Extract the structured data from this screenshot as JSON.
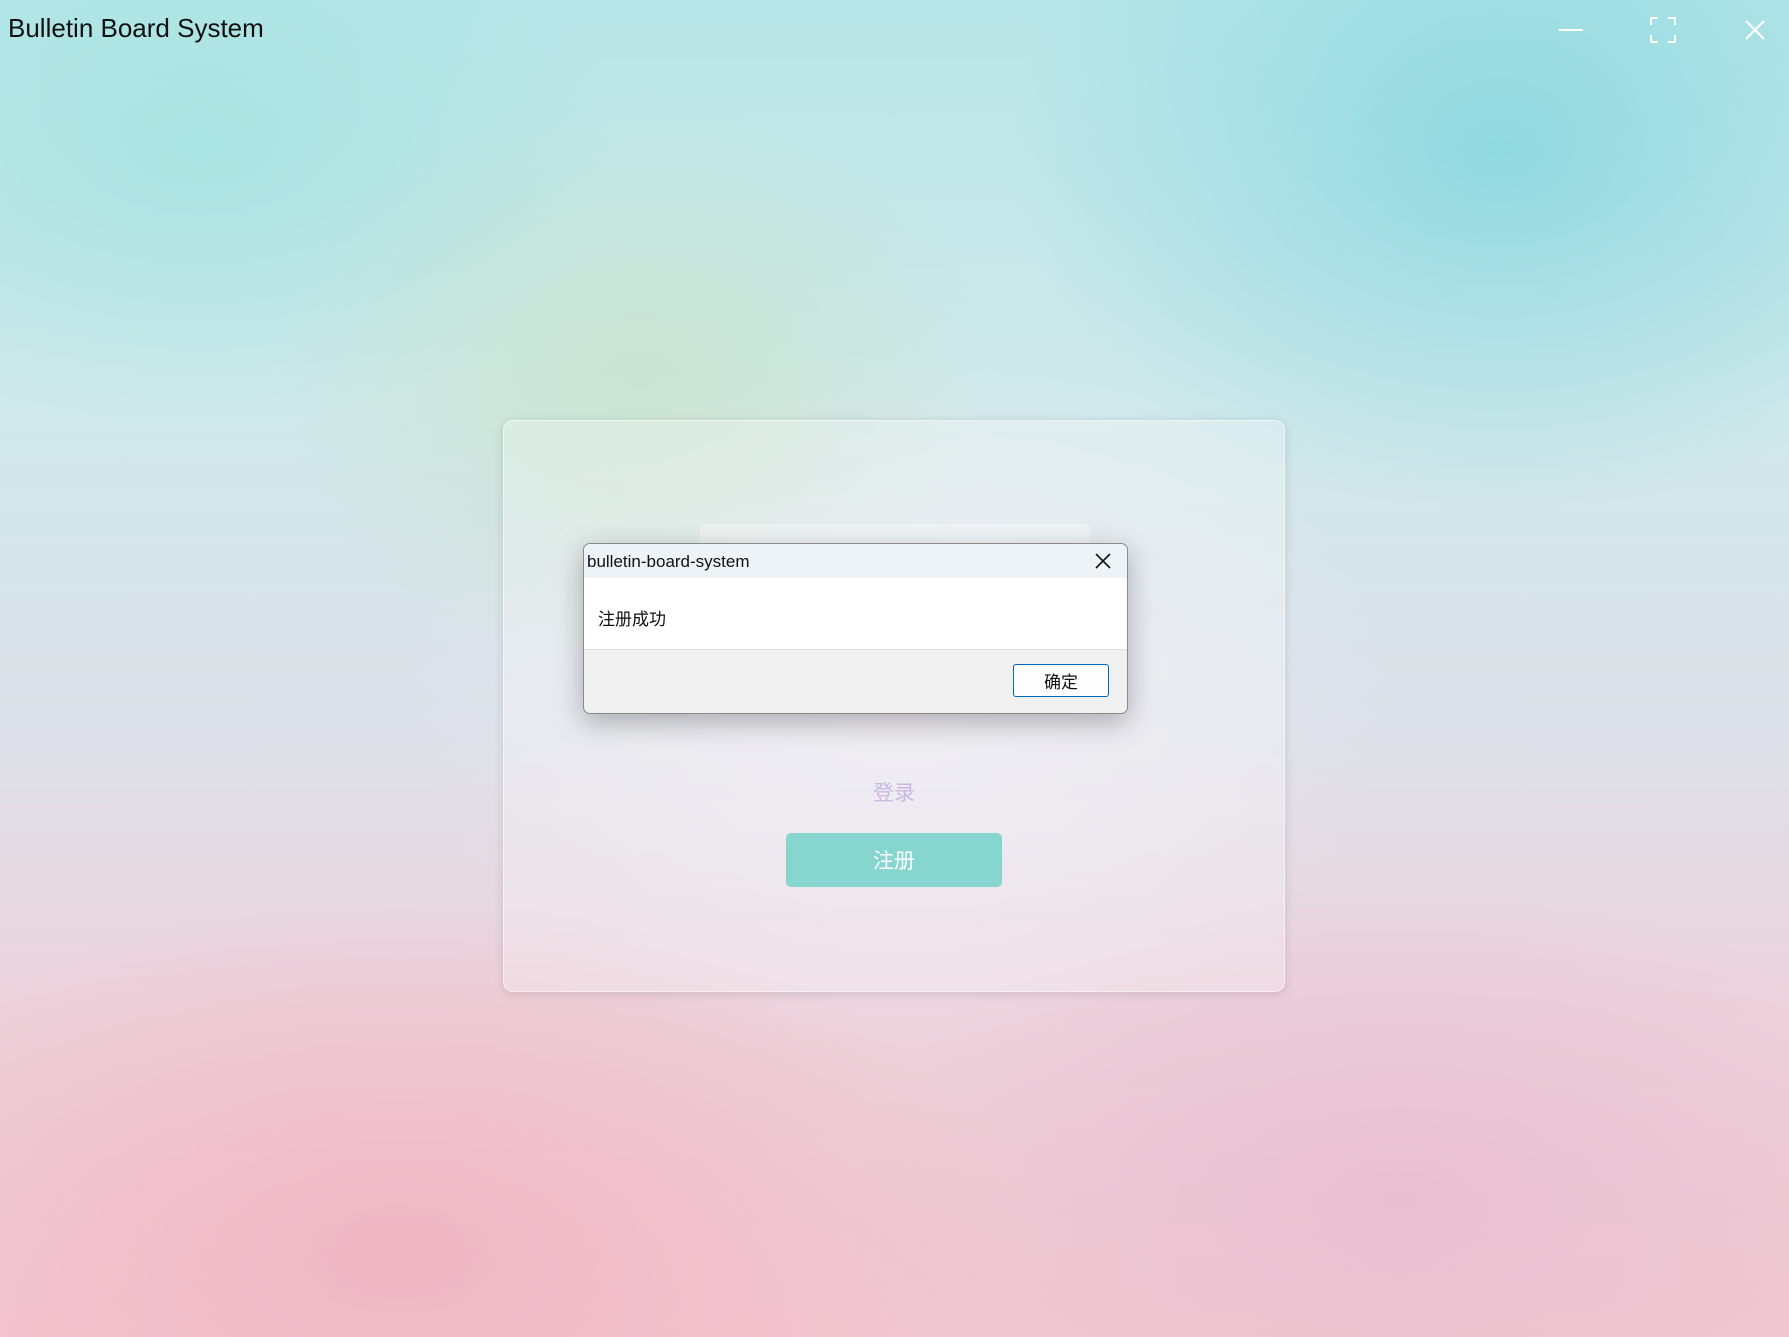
{
  "window": {
    "title": "Bulletin Board System",
    "controls": {
      "minimize_icon": "minimize-icon",
      "maximize_icon": "maximize-icon",
      "close_icon": "close-icon"
    }
  },
  "form": {
    "password_value": "•••••••",
    "login_link": "登录",
    "register_button": "注册"
  },
  "dialog": {
    "title": "bulletin-board-system",
    "message": "注册成功",
    "ok_button": "确定"
  },
  "colors": {
    "register_button": "#86d6cf",
    "login_link": "#c9b8e3",
    "dialog_ok_border": "#0067c0"
  }
}
